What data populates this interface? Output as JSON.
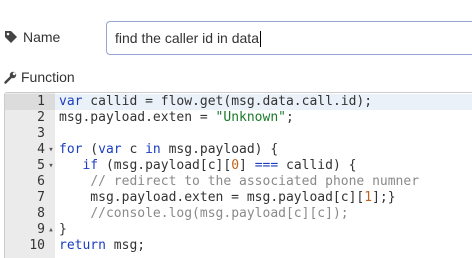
{
  "name_field": {
    "label": "Name",
    "value": "find the caller id in data",
    "icon": "tag-icon"
  },
  "function_section": {
    "label": "Function",
    "icon": "wrench-icon"
  },
  "editor": {
    "lines": [
      {
        "num": "1",
        "fold": "",
        "active": true,
        "tokens": [
          {
            "t": "var",
            "c": "kw"
          },
          {
            "t": " callid = flow.get(msg.data.call.id);",
            "c": ""
          }
        ]
      },
      {
        "num": "2",
        "fold": "",
        "active": false,
        "tokens": [
          {
            "t": "msg.payload.exten = ",
            "c": ""
          },
          {
            "t": "\"Unknown\"",
            "c": "str"
          },
          {
            "t": ";",
            "c": ""
          }
        ]
      },
      {
        "num": "3",
        "fold": "",
        "active": false,
        "tokens": []
      },
      {
        "num": "4",
        "fold": "▾",
        "active": false,
        "tokens": [
          {
            "t": "for",
            "c": "kw"
          },
          {
            "t": " (",
            "c": ""
          },
          {
            "t": "var",
            "c": "kw"
          },
          {
            "t": " c ",
            "c": ""
          },
          {
            "t": "in",
            "c": "kw"
          },
          {
            "t": " msg.payload) {",
            "c": ""
          }
        ]
      },
      {
        "num": "5",
        "fold": "▾",
        "active": false,
        "tokens": [
          {
            "t": "   ",
            "c": ""
          },
          {
            "t": "if",
            "c": "kw"
          },
          {
            "t": " (msg.payload[c][",
            "c": ""
          },
          {
            "t": "0",
            "c": "num"
          },
          {
            "t": "] ",
            "c": ""
          },
          {
            "t": "===",
            "c": "kw"
          },
          {
            "t": " callid) {",
            "c": ""
          }
        ]
      },
      {
        "num": "6",
        "fold": "",
        "active": false,
        "tokens": [
          {
            "t": "    ",
            "c": ""
          },
          {
            "t": "// redirect to the associated phone numner",
            "c": "cmt"
          }
        ]
      },
      {
        "num": "7",
        "fold": "",
        "active": false,
        "tokens": [
          {
            "t": "    msg.payload.exten = msg.payload[c][",
            "c": ""
          },
          {
            "t": "1",
            "c": "num"
          },
          {
            "t": "];}",
            "c": ""
          }
        ]
      },
      {
        "num": "8",
        "fold": "",
        "active": false,
        "tokens": [
          {
            "t": "    ",
            "c": ""
          },
          {
            "t": "//console.log(msg.payload[c][c]);",
            "c": "cmt"
          }
        ]
      },
      {
        "num": "9",
        "fold": "▴",
        "active": false,
        "tokens": [
          {
            "t": "}",
            "c": ""
          }
        ]
      },
      {
        "num": "10",
        "fold": "",
        "active": false,
        "tokens": [
          {
            "t": "return",
            "c": "kw"
          },
          {
            "t": " msg;",
            "c": ""
          }
        ]
      }
    ]
  }
}
